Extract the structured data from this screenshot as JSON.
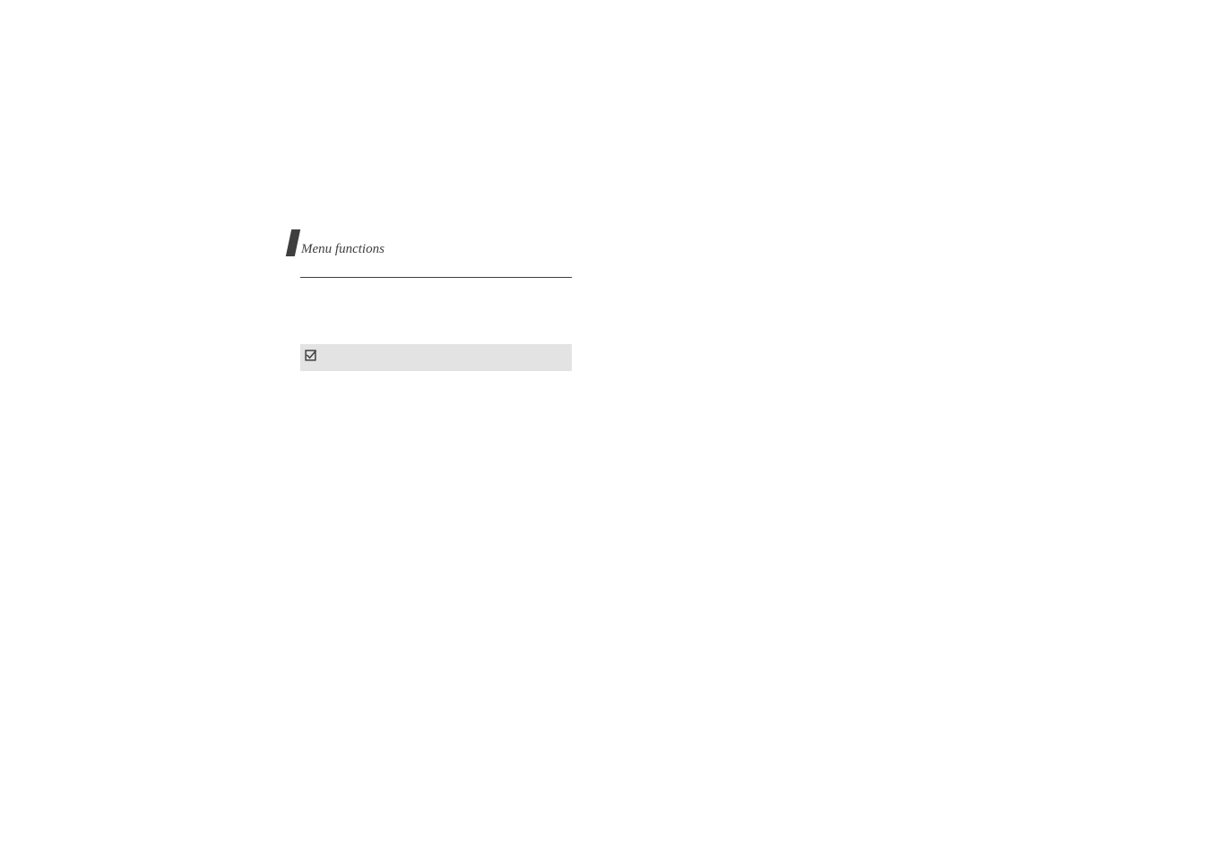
{
  "header": {
    "title": "Menu functions"
  },
  "note": {
    "icon_name": "checkbox-checked-icon",
    "text": ""
  }
}
